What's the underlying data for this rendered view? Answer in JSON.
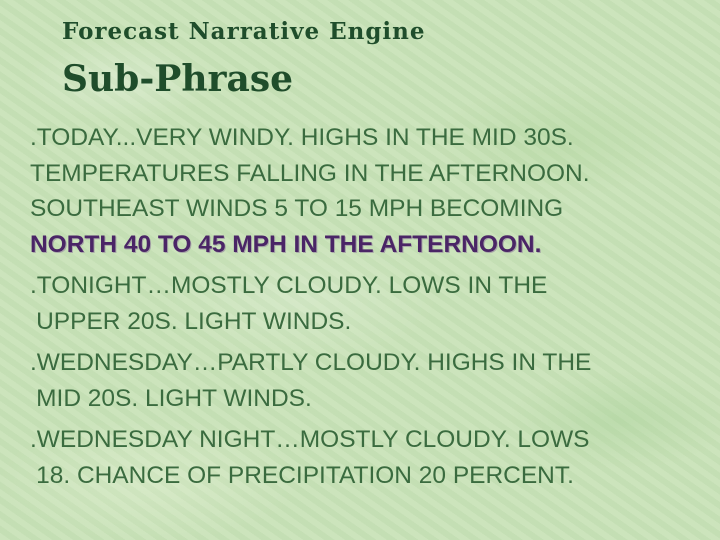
{
  "slide": {
    "subtitle": "Forecast Narrative Engine",
    "title": "Sub-Phrase"
  },
  "paragraphs": [
    {
      "lines": [
        ".TODAY...VERY WINDY. HIGHS IN THE MID 30S.",
        "TEMPERATURES FALLING IN THE AFTERNOON.",
        "SOUTHEAST WINDS 5 TO 15 MPH BECOMING"
      ],
      "highlight": "NORTH 40 TO 45 MPH IN THE AFTERNOON."
    },
    {
      "lines": [
        ".TONIGHT…MOSTLY CLOUDY. LOWS IN THE",
        "UPPER 20S.  LIGHT WINDS."
      ]
    },
    {
      "lines": [
        ".WEDNESDAY…PARTLY CLOUDY. HIGHS IN THE",
        "MID 20S. LIGHT WINDS."
      ]
    },
    {
      "lines": [
        ".WEDNESDAY NIGHT…MOSTLY CLOUDY. LOWS",
        "18. CHANCE OF PRECIPITATION 20 PERCENT."
      ]
    }
  ],
  "colors": {
    "background": "#c9e2b8",
    "heading": "#1f4d2b",
    "body_text": "#3a6b3f",
    "highlight": "#4a2566"
  }
}
